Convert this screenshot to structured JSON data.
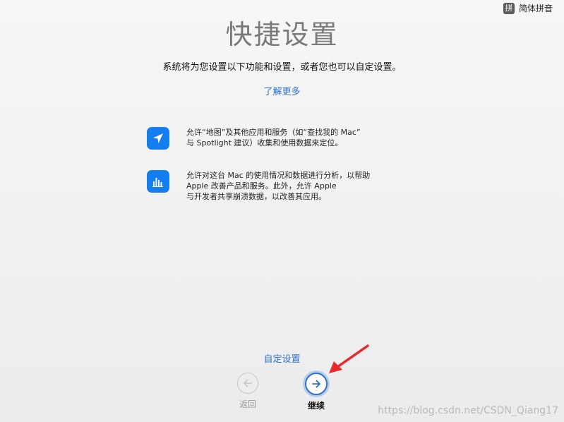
{
  "input_menu": {
    "badge": "拼",
    "label": "简体拼音"
  },
  "header": {
    "title": "快捷设置",
    "subtitle": "系统将为您设置以下功能和设置，或者您也可以自定设置。",
    "learn_more": "了解更多"
  },
  "features": [
    {
      "icon": "location-arrow-icon",
      "text": "允许“地图”及其他应用和服务（如“查找我的 Mac”\n与 Spotlight 建议）收集和使用数据来定位。"
    },
    {
      "icon": "bar-chart-icon",
      "text": "允许对这台 Mac 的使用情况和数据进行分析，以帮助\nApple 改善产品和服务。此外，允许 Apple\n与开发者共享崩溃数据，以改善其应用。"
    }
  ],
  "footer": {
    "custom_setup": "自定设置",
    "back_label": "返回",
    "continue_label": "继续"
  },
  "colors": {
    "accent": "#2f73c9",
    "icon_blue": "#147ef0",
    "annotation_red": "#e8282b"
  },
  "watermark": "https://blog.csdn.net/CSDN_Qiang17"
}
